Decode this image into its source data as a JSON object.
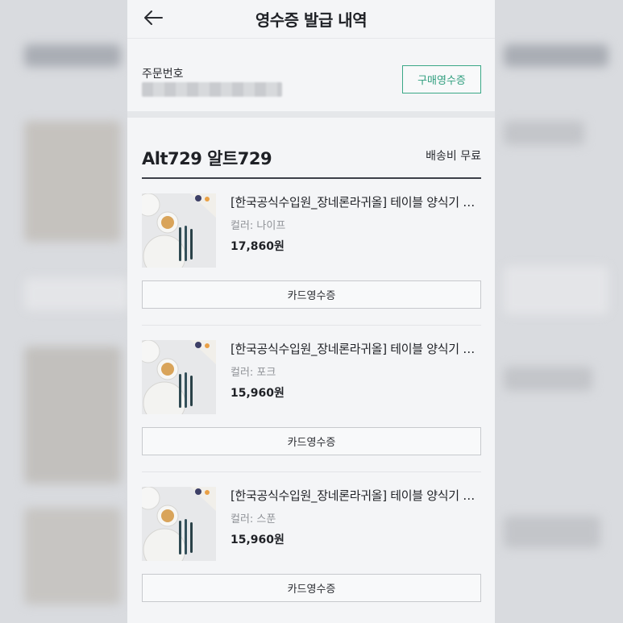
{
  "header": {
    "title": "영수증 발급 내역",
    "back_icon": "arrow-left-icon"
  },
  "order": {
    "label": "주문번호",
    "number": "",
    "purchase_receipt_label": "구매영수증",
    "accent_color": "#2e9d7d"
  },
  "seller": {
    "name": "Alt729 알트729",
    "shipping": "배송비 무료"
  },
  "items": [
    {
      "title": "[한국공식수입원_장네론라귀올] 테이블 양식기 세트",
      "option": "컬러: 나이프",
      "price": "17,860원",
      "receipt_label": "카드영수증"
    },
    {
      "title": "[한국공식수입원_장네론라귀올] 테이블 양식기 세트",
      "option": "컬러: 포크",
      "price": "15,960원",
      "receipt_label": "카드영수증"
    },
    {
      "title": "[한국공식수입원_장네론라귀올] 테이블 양식기 세트",
      "option": "컬러: 스푼",
      "price": "15,960원",
      "receipt_label": "카드영수증"
    }
  ]
}
